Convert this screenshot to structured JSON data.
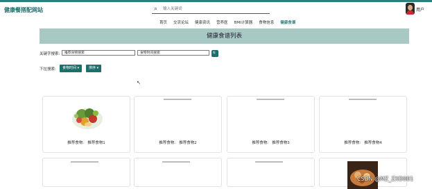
{
  "app": {
    "title": "健康餐搭配网站"
  },
  "header": {
    "search_placeholder": "输入关键词",
    "user_label": "用户"
  },
  "nav": {
    "items": [
      "首页",
      "交流论坛",
      "健康资讯",
      "营养医",
      "BMI计算器",
      "食物信息",
      "健康食谱"
    ],
    "active": "健康食谱"
  },
  "banner": {
    "title": "健康食谱列表"
  },
  "filters": {
    "keyword_label": "关键字搜索:",
    "field1_value": "推荐食物搜索",
    "field2_value": "食物时间搜索",
    "search_icon": "🔍",
    "dropdown_label": "下拉搜索:",
    "dropdown1": "食物时间",
    "dropdown2": "排序"
  },
  "cards": [
    {
      "prefix": "推荐食物:",
      "name": "推荐食物1"
    },
    {
      "prefix": "推荐食物:",
      "name": "推荐食物2"
    },
    {
      "prefix": "推荐食物:",
      "name": "推荐食物3"
    },
    {
      "prefix": "推荐食物:",
      "name": "推荐食物4"
    }
  ],
  "watermark": "CSDN @MZ_ZXD001",
  "colors": {
    "accent": "#1e6f6a",
    "banner": "#a8c8c3",
    "brand": "#1c6e6a"
  }
}
